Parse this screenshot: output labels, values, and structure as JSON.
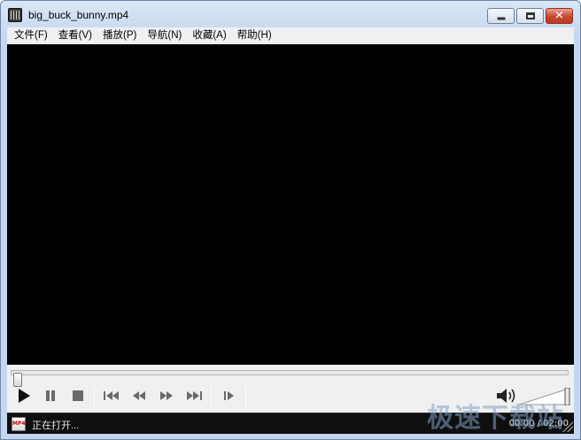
{
  "window": {
    "title": "big_buck_bunny.mp4",
    "icons": {
      "app": "film-clapper-icon",
      "minimize": "minimize-icon",
      "maximize": "maximize-icon",
      "close": "close-icon"
    },
    "close_glyph": "✕"
  },
  "menubar": {
    "items": [
      {
        "label": "文件(F)"
      },
      {
        "label": "查看(V)"
      },
      {
        "label": "播放(P)"
      },
      {
        "label": "导航(N)"
      },
      {
        "label": "收藏(A)"
      },
      {
        "label": "帮助(H)"
      }
    ]
  },
  "seek": {
    "progress": 0.0
  },
  "controls": {
    "buttons": [
      "play-icon",
      "pause-icon",
      "stop-icon",
      "skip-back-icon",
      "rewind-icon",
      "fast-forward-icon",
      "skip-forward-icon",
      "frame-step-icon"
    ],
    "volume_icon": "speaker-icon"
  },
  "status": {
    "text": "正在打开...",
    "file_badge": "MP4",
    "time": "00:00 / 02:00"
  },
  "watermark": {
    "text": "极速下载站"
  },
  "colors": {
    "video_bg": "#000000",
    "status_bg": "#0f0f0f",
    "chrome": "#f0f0f0",
    "close_red": "#c7452e"
  }
}
